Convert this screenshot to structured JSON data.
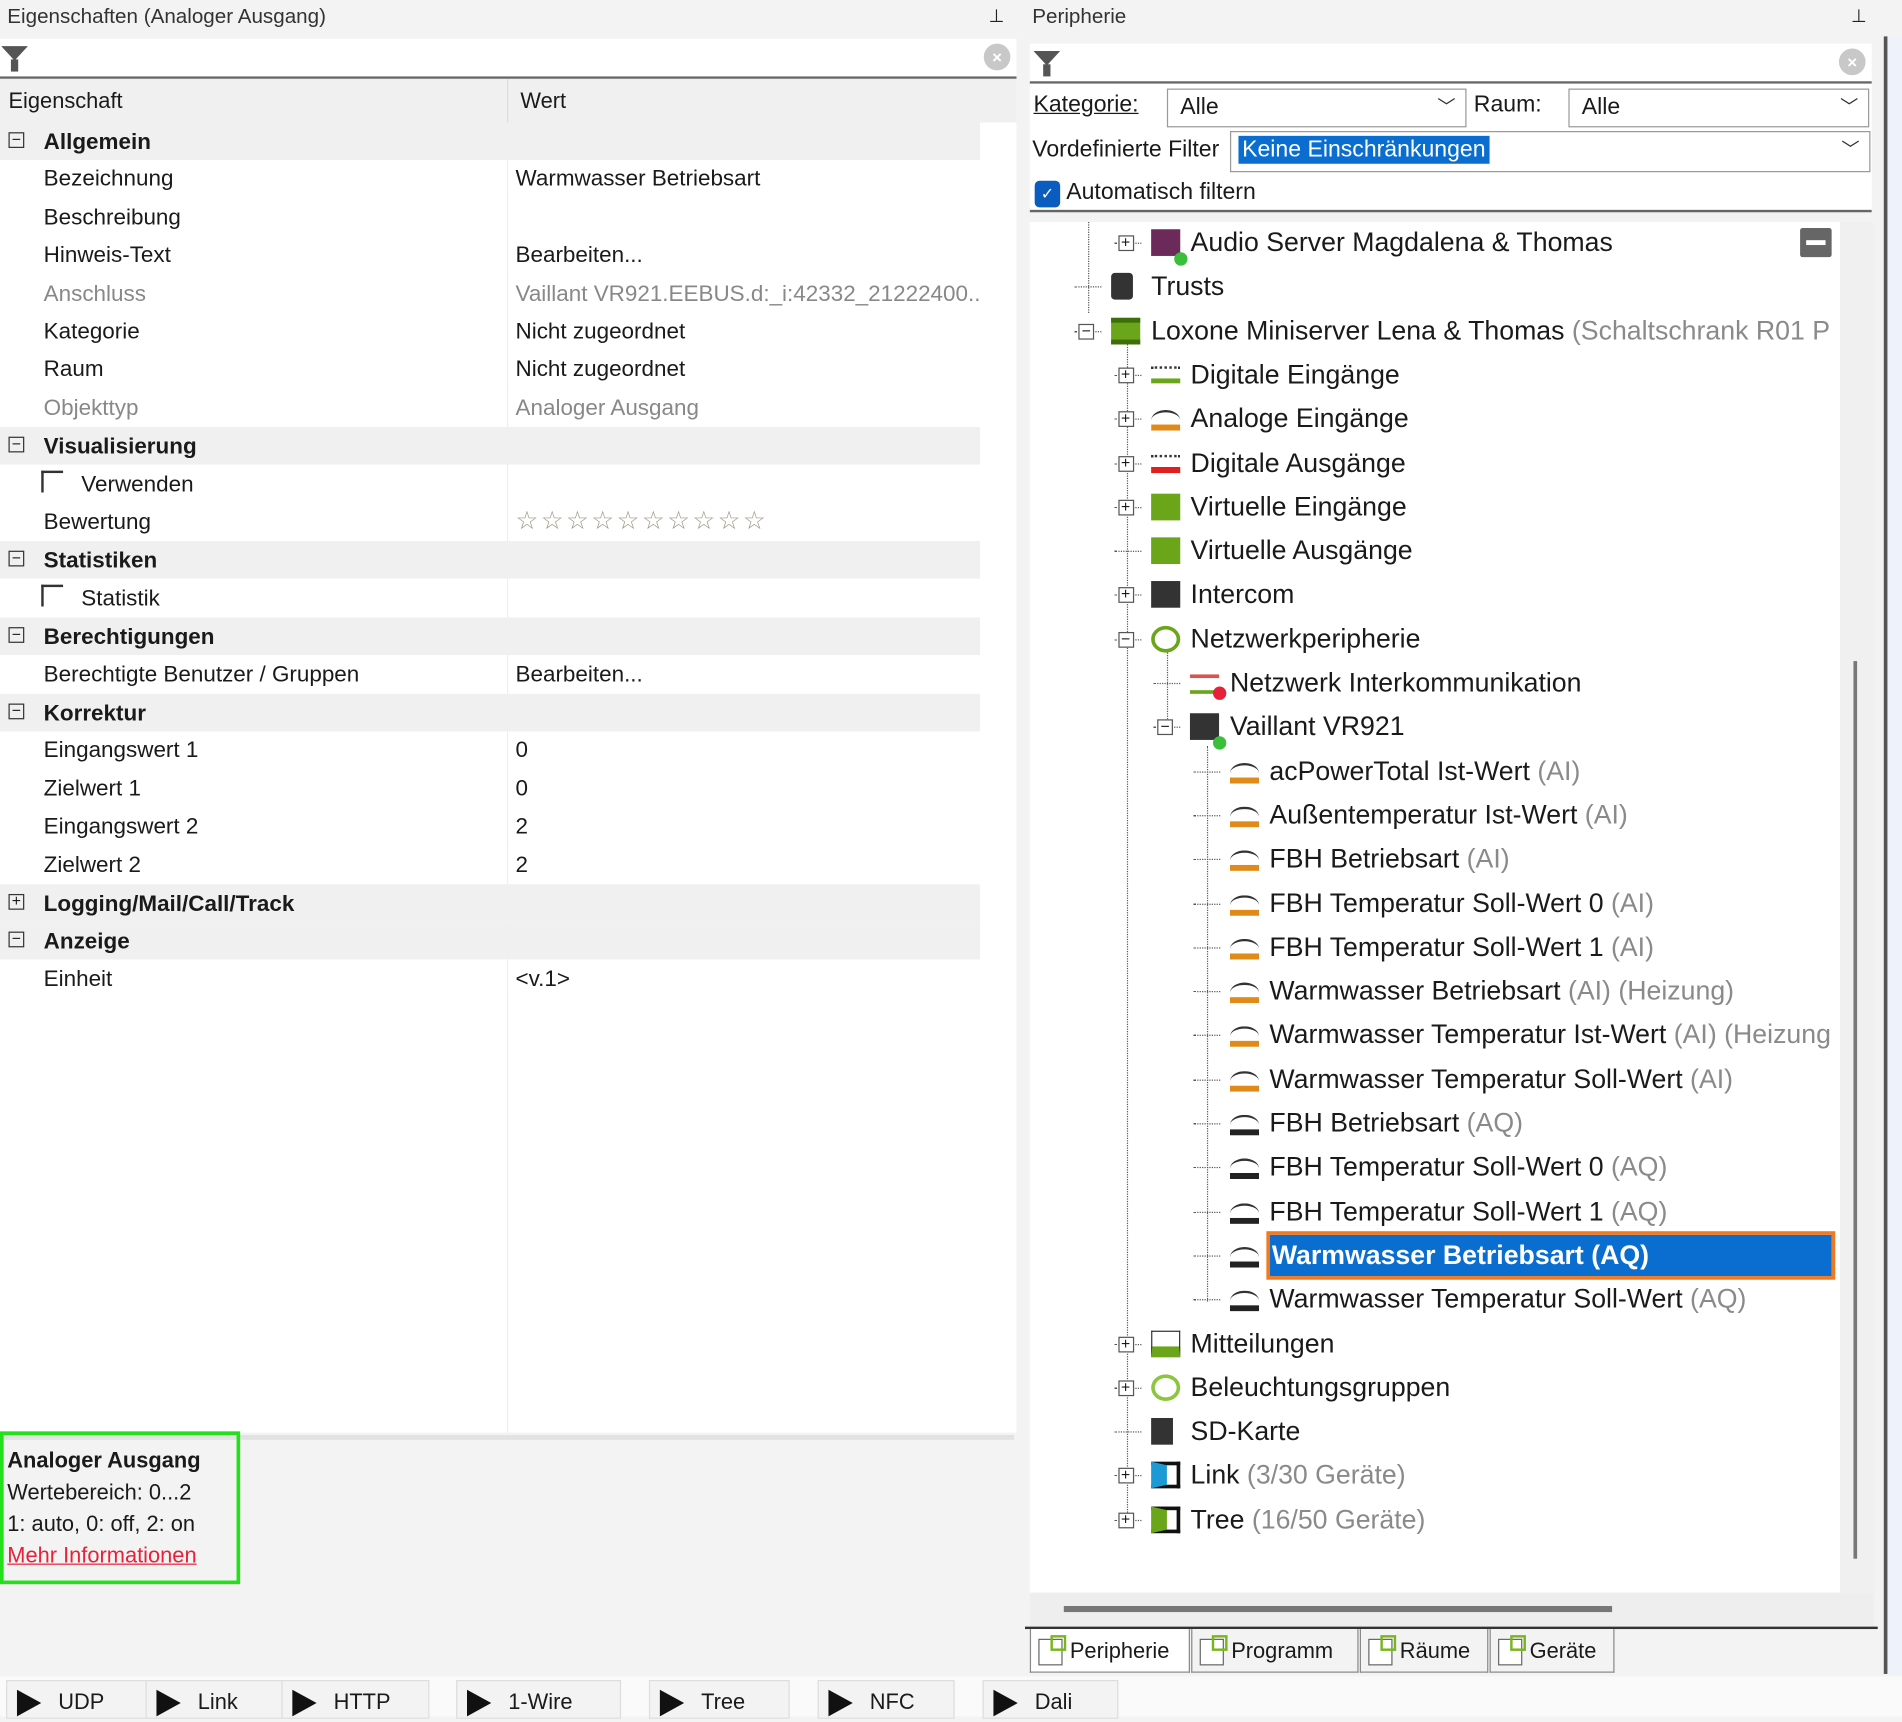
{
  "left": {
    "title": "Eigenschaften (Analoger Ausgang)",
    "columns": [
      "Eigenschaft",
      "Wert"
    ],
    "rows": [
      {
        "type": "group",
        "label": "Allgemein",
        "expanded": true
      },
      {
        "label": "Bezeichnung",
        "value": "Warmwasser Betriebsart"
      },
      {
        "label": "Beschreibung",
        "value": ""
      },
      {
        "label": "Hinweis-Text",
        "value": "Bearbeiten..."
      },
      {
        "label": "Anschluss",
        "value": "Vaillant VR921.EEBUS.d:_i:42332_21222400...",
        "disabled": true
      },
      {
        "label": "Kategorie",
        "value": "Nicht zugeordnet"
      },
      {
        "label": "Raum",
        "value": "Nicht zugeordnet"
      },
      {
        "label": "Objekttyp",
        "value": "Analoger Ausgang",
        "disabled": true
      },
      {
        "type": "group",
        "label": "Visualisierung",
        "expanded": true
      },
      {
        "label": "Verwenden",
        "value": "",
        "checkbox": false
      },
      {
        "label": "Bewertung",
        "value": "☆☆☆☆☆☆☆☆☆☆",
        "stars": true
      },
      {
        "type": "group",
        "label": "Statistiken",
        "expanded": true
      },
      {
        "label": "Statistik",
        "value": "",
        "checkbox": false
      },
      {
        "type": "group",
        "label": "Berechtigungen",
        "expanded": true
      },
      {
        "label": "Berechtigte Benutzer / Gruppen",
        "value": "Bearbeiten..."
      },
      {
        "type": "group",
        "label": "Korrektur",
        "expanded": true
      },
      {
        "label": "Eingangswert 1",
        "value": "0"
      },
      {
        "label": "Zielwert 1",
        "value": "0"
      },
      {
        "label": "Eingangswert 2",
        "value": "2"
      },
      {
        "label": "Zielwert 2",
        "value": "2"
      },
      {
        "type": "group",
        "label": "Logging/Mail/Call/Track",
        "expanded": false
      },
      {
        "type": "group",
        "label": "Anzeige",
        "expanded": true
      },
      {
        "label": "Einheit",
        "value": "<v.1>"
      }
    ],
    "info": {
      "title": "Analoger Ausgang",
      "line1": "Wertebereich: 0...2",
      "line2": "1: auto, 0: off, 2: on",
      "link": "Mehr Informationen"
    }
  },
  "right": {
    "title": "Peripherie",
    "kategorie_label": "Kategorie:",
    "kategorie_value": "Alle",
    "raum_label": "Raum:",
    "raum_value": "Alle",
    "filter_label": "Vordefinierte Filter",
    "filter_value": "Keine Einschränkungen",
    "auto_filter_label": "Automatisch filtern",
    "auto_filter_checked": true,
    "tree": [
      {
        "level": 1,
        "exp": "+",
        "icon": "audio-server",
        "label": "Audio Server Magdalena & Thomas",
        "suffix": ""
      },
      {
        "level": 0.5,
        "exp": "",
        "icon": "trusts",
        "label": "Trusts",
        "suffix": ""
      },
      {
        "level": 0,
        "exp": "-",
        "icon": "miniserver",
        "label": "Loxone Miniserver Lena & Thomas",
        "suffix": " (Schaltschrank R01 P"
      },
      {
        "level": 1,
        "exp": "+",
        "icon": "digital-in",
        "label": "Digitale Eingänge",
        "suffix": ""
      },
      {
        "level": 1,
        "exp": "+",
        "icon": "analog-in",
        "label": "Analoge Eingänge",
        "suffix": ""
      },
      {
        "level": 1,
        "exp": "+",
        "icon": "digital-out",
        "label": "Digitale Ausgänge",
        "suffix": ""
      },
      {
        "level": 1,
        "exp": "+",
        "icon": "virtual-in",
        "label": "Virtuelle Eingänge",
        "suffix": ""
      },
      {
        "level": 1,
        "exp": "",
        "icon": "virtual-out",
        "label": "Virtuelle Ausgänge",
        "suffix": ""
      },
      {
        "level": 1,
        "exp": "+",
        "icon": "intercom",
        "label": "Intercom",
        "suffix": ""
      },
      {
        "level": 1,
        "exp": "-",
        "icon": "network",
        "label": "Netzwerkperipherie",
        "suffix": ""
      },
      {
        "level": 2,
        "exp": "",
        "icon": "intercommunication",
        "label": "Netzwerk Interkommunikation",
        "suffix": ""
      },
      {
        "level": 2,
        "exp": "-",
        "icon": "eebus",
        "label": "Vaillant VR921",
        "suffix": ""
      },
      {
        "level": 3,
        "exp": "",
        "icon": "analog-in",
        "label": "acPowerTotal Ist-Wert",
        "suffix": " (AI)"
      },
      {
        "level": 3,
        "exp": "",
        "icon": "analog-in",
        "label": "Außentemperatur Ist-Wert",
        "suffix": " (AI)"
      },
      {
        "level": 3,
        "exp": "",
        "icon": "analog-in",
        "label": "FBH Betriebsart",
        "suffix": " (AI)"
      },
      {
        "level": 3,
        "exp": "",
        "icon": "analog-in",
        "label": "FBH Temperatur Soll-Wert 0",
        "suffix": " (AI)"
      },
      {
        "level": 3,
        "exp": "",
        "icon": "analog-in",
        "label": "FBH Temperatur Soll-Wert 1",
        "suffix": " (AI)"
      },
      {
        "level": 3,
        "exp": "",
        "icon": "analog-in",
        "label": "Warmwasser Betriebsart",
        "suffix": " (AI) (Heizung)"
      },
      {
        "level": 3,
        "exp": "",
        "icon": "analog-in",
        "label": "Warmwasser Temperatur Ist-Wert",
        "suffix": " (AI) (Heizung"
      },
      {
        "level": 3,
        "exp": "",
        "icon": "analog-in",
        "label": "Warmwasser Temperatur Soll-Wert",
        "suffix": " (AI)"
      },
      {
        "level": 3,
        "exp": "",
        "icon": "analog-out",
        "label": "FBH Betriebsart",
        "suffix": " (AQ)"
      },
      {
        "level": 3,
        "exp": "",
        "icon": "analog-out",
        "label": "FBH Temperatur Soll-Wert 0",
        "suffix": " (AQ)"
      },
      {
        "level": 3,
        "exp": "",
        "icon": "analog-out",
        "label": "FBH Temperatur Soll-Wert 1",
        "suffix": " (AQ)"
      },
      {
        "level": 3,
        "exp": "",
        "icon": "analog-out",
        "label": "Warmwasser Betriebsart (AQ)",
        "suffix": "",
        "selected": true
      },
      {
        "level": 3,
        "exp": "",
        "icon": "analog-out",
        "label": "Warmwasser Temperatur Soll-Wert",
        "suffix": " (AQ)"
      },
      {
        "level": 1,
        "exp": "+",
        "icon": "log",
        "label": "Mitteilungen",
        "suffix": ""
      },
      {
        "level": 1,
        "exp": "+",
        "icon": "lighting",
        "label": "Beleuchtungsgruppen",
        "suffix": ""
      },
      {
        "level": 1,
        "exp": "",
        "icon": "sd-card",
        "label": "SD-Karte",
        "suffix": ""
      },
      {
        "level": 1,
        "exp": "+",
        "icon": "link",
        "label": "Link",
        "suffix": " (3/30 Geräte)"
      },
      {
        "level": 1,
        "exp": "+",
        "icon": "tree",
        "label": "Tree",
        "suffix": "  (16/50 Geräte)"
      }
    ],
    "tabs": [
      "Peripherie",
      "Programm",
      "Räume",
      "Geräte"
    ]
  },
  "bottom_tabs": [
    "UDP",
    "Link",
    "HTTP",
    "1-Wire",
    "Tree",
    "NFC",
    "Dali"
  ],
  "colors": {
    "selection": "#0a6ed1",
    "selection_border": "#f07a22",
    "info_border": "#22e01a",
    "link": "#e8213a",
    "green": "#6aa51a"
  }
}
